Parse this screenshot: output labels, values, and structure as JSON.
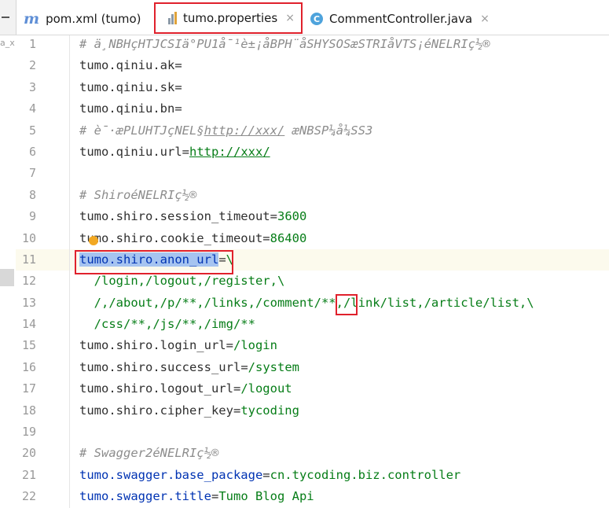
{
  "tabs": [
    {
      "label": "pom.xml (tumo)",
      "icon": "maven-m-icon",
      "active": false,
      "close": ""
    },
    {
      "label": "tumo.properties",
      "icon": "properties-file-icon",
      "active": true,
      "close": "×"
    },
    {
      "label": "CommentController.java",
      "icon": "java-class-icon",
      "active": false,
      "close": "×"
    }
  ],
  "left_fragment": "a_x",
  "colors": {
    "highlight_box": "#e0212c",
    "selection": "#a6c4f0",
    "value": "#067d17",
    "comment": "#8c8c8c"
  },
  "lines": [
    {
      "n": "1",
      "parts": [
        {
          "t": "# ä¸NBHçHTJCSIä°PU1å¯¹è±¡åBPH¨åSHYSOSæSTRIåVTS¡éNELRIç½®",
          "c": "comment"
        }
      ]
    },
    {
      "n": "2",
      "parts": [
        {
          "t": "tumo.qiniu.ak",
          "c": "key"
        },
        {
          "t": "=",
          "c": "key"
        }
      ]
    },
    {
      "n": "3",
      "parts": [
        {
          "t": "tumo.qiniu.sk",
          "c": "key"
        },
        {
          "t": "=",
          "c": "key"
        }
      ]
    },
    {
      "n": "4",
      "parts": [
        {
          "t": "tumo.qiniu.bn",
          "c": "key"
        },
        {
          "t": "=",
          "c": "key"
        }
      ]
    },
    {
      "n": "5",
      "parts": [
        {
          "t": "# è¯·æPLUHTJçNEL§",
          "c": "comment"
        },
        {
          "t": "http://xxx/",
          "c": "comment url"
        },
        {
          "t": " æNBSP¼å¼SS3",
          "c": "comment"
        }
      ]
    },
    {
      "n": "6",
      "parts": [
        {
          "t": "tumo.qiniu.url",
          "c": "key"
        },
        {
          "t": "=",
          "c": "key"
        },
        {
          "t": "http://xxx/",
          "c": "val url"
        }
      ]
    },
    {
      "n": "7",
      "parts": []
    },
    {
      "n": "8",
      "parts": [
        {
          "t": "# ShiroéNELRIç½®",
          "c": "comment"
        }
      ]
    },
    {
      "n": "9",
      "parts": [
        {
          "t": "tumo.shiro.session_timeout",
          "c": "key"
        },
        {
          "t": "=",
          "c": "key"
        },
        {
          "t": "3600",
          "c": "val"
        }
      ]
    },
    {
      "n": "10",
      "parts": [
        {
          "t": "tumo.shiro.cookie_timeout",
          "c": "key"
        },
        {
          "t": "=",
          "c": "key"
        },
        {
          "t": "86400",
          "c": "val"
        }
      ]
    },
    {
      "n": "11",
      "parts": [
        {
          "t": "tumo.shiro.anon_url",
          "c": "key-blue sel"
        },
        {
          "t": "=",
          "c": "key"
        },
        {
          "t": "\\",
          "c": "val"
        }
      ]
    },
    {
      "n": "12",
      "parts": [
        {
          "t": "  /login,/logout,/register,\\",
          "c": "val"
        }
      ]
    },
    {
      "n": "13",
      "parts": [
        {
          "t": "  /,/about,/p/**,/links,/comment/**,/link/list,/article/list,\\",
          "c": "val"
        }
      ]
    },
    {
      "n": "14",
      "parts": [
        {
          "t": "  /css/**,/js/**,/img/**",
          "c": "val"
        }
      ]
    },
    {
      "n": "15",
      "parts": [
        {
          "t": "tumo.shiro.login_url",
          "c": "key"
        },
        {
          "t": "=",
          "c": "key"
        },
        {
          "t": "/login",
          "c": "val"
        }
      ]
    },
    {
      "n": "16",
      "parts": [
        {
          "t": "tumo.shiro.success_url",
          "c": "key"
        },
        {
          "t": "=",
          "c": "key"
        },
        {
          "t": "/system",
          "c": "val"
        }
      ]
    },
    {
      "n": "17",
      "parts": [
        {
          "t": "tumo.shiro.logout_url",
          "c": "key"
        },
        {
          "t": "=",
          "c": "key"
        },
        {
          "t": "/logout",
          "c": "val"
        }
      ]
    },
    {
      "n": "18",
      "parts": [
        {
          "t": "tumo.shiro.cipher_key",
          "c": "key"
        },
        {
          "t": "=",
          "c": "key"
        },
        {
          "t": "tycoding",
          "c": "val"
        }
      ]
    },
    {
      "n": "19",
      "parts": []
    },
    {
      "n": "20",
      "parts": [
        {
          "t": "# Swagger2éNELRIç½®",
          "c": "comment"
        }
      ]
    },
    {
      "n": "21",
      "parts": [
        {
          "t": "tumo.swagger.base_package",
          "c": "key-blue"
        },
        {
          "t": "=",
          "c": "key"
        },
        {
          "t": "cn.tycoding.biz.controller",
          "c": "val"
        }
      ]
    },
    {
      "n": "22",
      "parts": [
        {
          "t": "tumo.swagger.title",
          "c": "key-blue"
        },
        {
          "t": "=",
          "c": "key"
        },
        {
          "t": "Tumo Blog Api",
          "c": "val"
        }
      ]
    }
  ]
}
